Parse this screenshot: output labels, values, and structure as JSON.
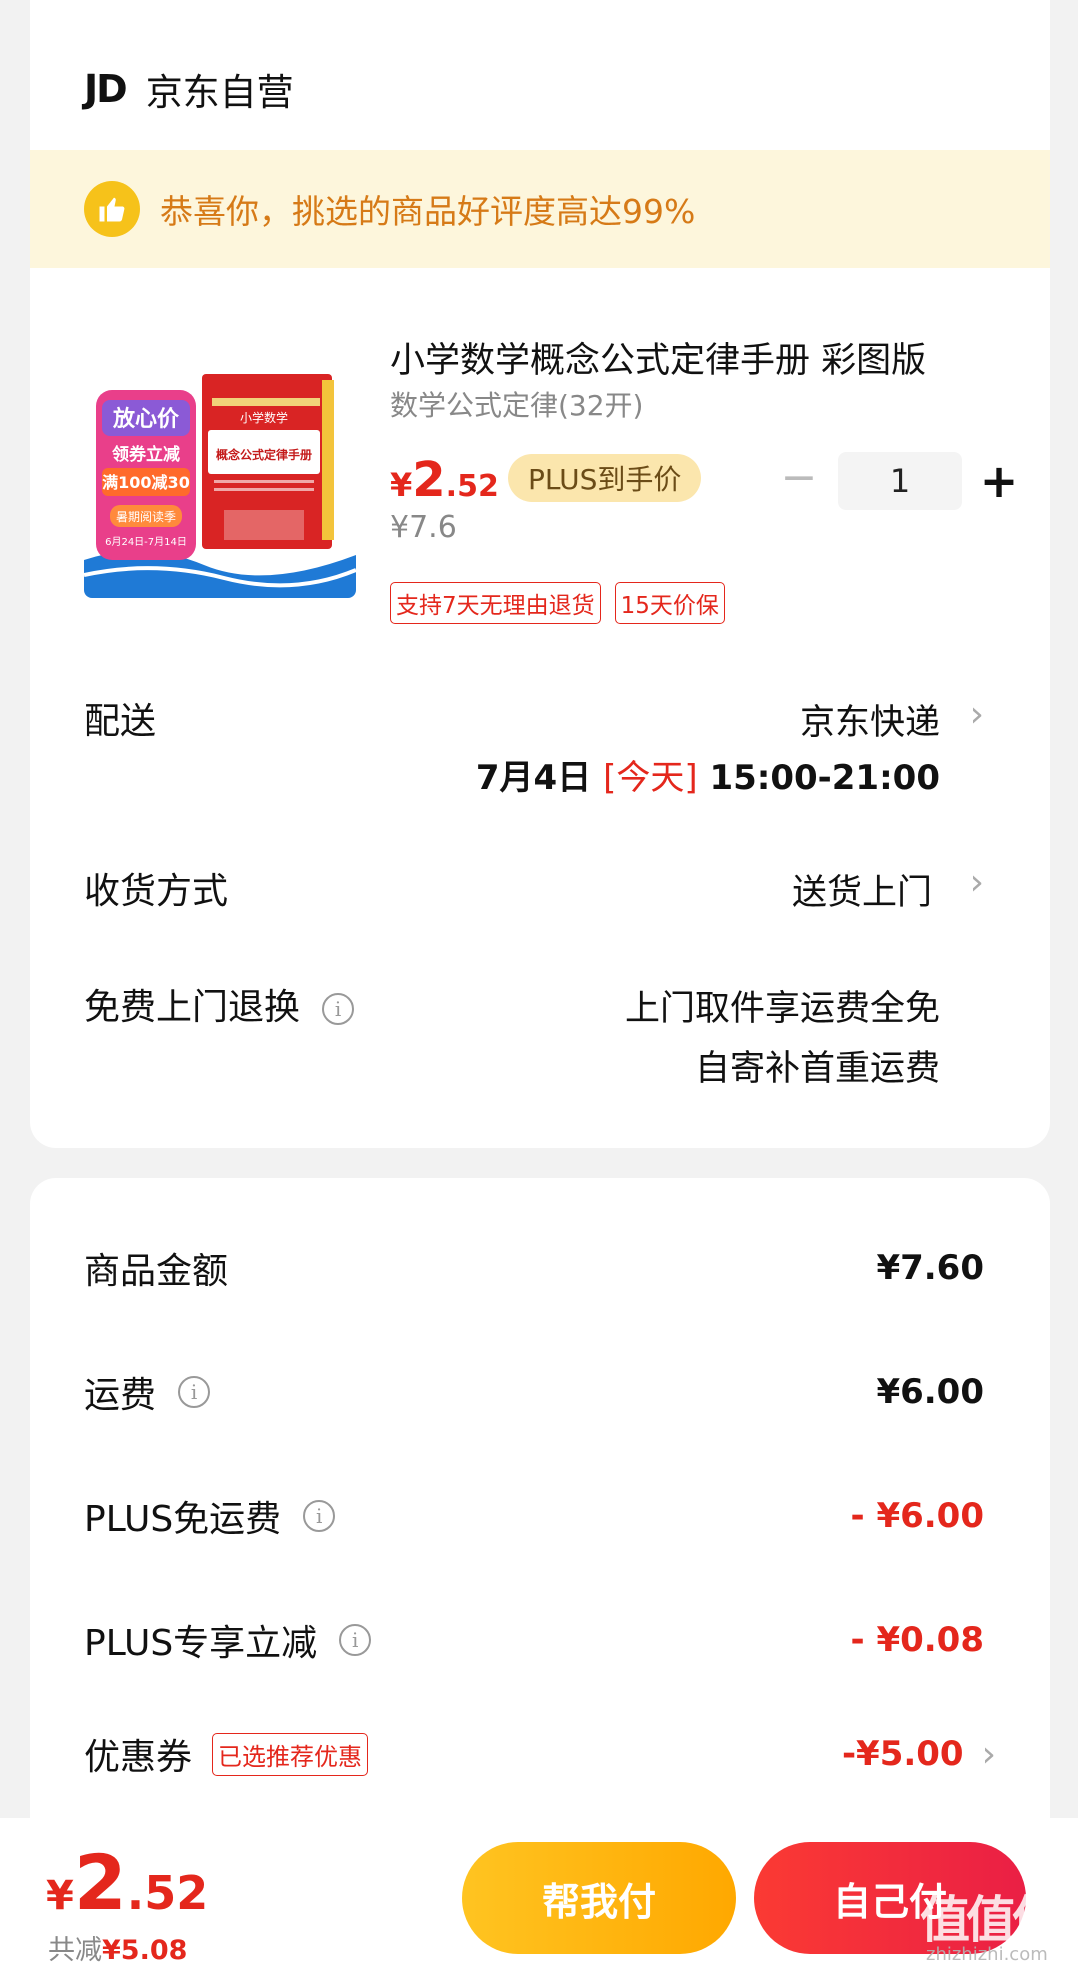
{
  "store": {
    "logo": "JD",
    "name": "京东自营"
  },
  "promo": {
    "icon": "thumbs-up-icon",
    "text": "恭喜你，挑选的商品好评度高达99%"
  },
  "product": {
    "title": "小学数学概念公式定律手册 彩图版",
    "spec": "数学公式定律(32开)",
    "price_yen": "¥",
    "price_int": "2",
    "price_dec": ".52",
    "plus_tag": "PLUS到手价",
    "orig_price": "¥7.6",
    "qty_minus": "−",
    "qty": "1",
    "qty_plus": "+",
    "badges": [
      "支持7天无理由退货",
      "15天价保"
    ],
    "image": {
      "burst_text": "放心价",
      "coupon_line1": "领券立减",
      "coupon_line2": "满100减30",
      "event": "暑期阅读季",
      "date": "6月24日-7月14日",
      "book_series": "小学数学",
      "book_title": "概念公式定律手册"
    }
  },
  "delivery": {
    "label": "配送",
    "carrier": "京东快递",
    "date": "7月4日",
    "today": "[今天]",
    "time": "15:00-21:00"
  },
  "receipt": {
    "label": "收货方式",
    "value": "送货上门"
  },
  "returns": {
    "label": "免费上门退换",
    "line1": "上门取件享运费全免",
    "line2": "自寄补首重运费"
  },
  "summary": [
    {
      "label": "商品金额",
      "value": "¥7.60",
      "info": false
    },
    {
      "label": "运费",
      "value": "¥6.00",
      "info": true
    },
    {
      "label": "PLUS免运费",
      "value": "- ¥6.00",
      "info": true
    },
    {
      "label": "PLUS专享立减",
      "value": "- ¥0.08",
      "info": true
    },
    {
      "label": "优惠券",
      "value": "-¥5.00",
      "tag": "已选推荐优惠"
    }
  ],
  "bottom": {
    "total_yen": "¥",
    "total_int": "2",
    "total_dec": ".52",
    "saved_label": "共减",
    "saved_value": "¥5.08",
    "help_pay": "帮我付",
    "self_pay": "自己付"
  },
  "watermark": {
    "main": "值值值",
    "sub": "zhizhizhi.com"
  },
  "colors": {
    "accent_red": "#e4271c",
    "promo_bg": "#fdf6dc",
    "promo_text": "#d67a17",
    "help_btn": "#ffb70f",
    "self_btn": "#f02d3d"
  }
}
